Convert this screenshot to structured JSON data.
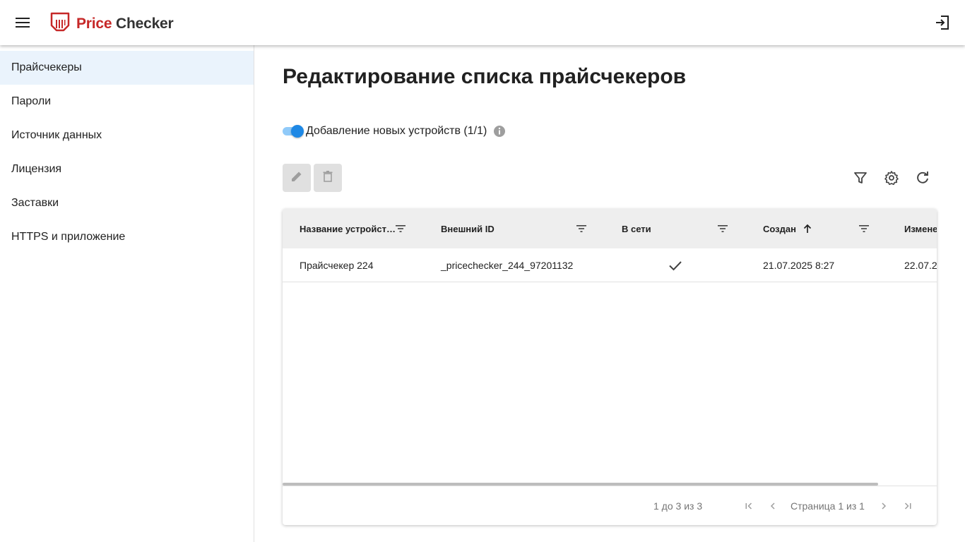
{
  "app": {
    "brand_part1": "Price",
    "brand_part2": "Checker",
    "brand_color": "#c62828",
    "icons": {
      "menu": "menu-icon",
      "logo": "barcode-tag-icon",
      "exit": "exit-icon"
    }
  },
  "sidebar": {
    "items": [
      {
        "label": "Прайсчекеры",
        "active": true
      },
      {
        "label": "Пароли"
      },
      {
        "label": "Источник данных"
      },
      {
        "label": "Лицензия"
      },
      {
        "label": "Заставки"
      },
      {
        "label": "HTTPS и приложение"
      }
    ],
    "active_bg": "#eaf3fc"
  },
  "main": {
    "title": "Редактирование списка прайсчекеров",
    "toggle": {
      "label": "Добавление новых устройств (1/1)",
      "checked": true,
      "color": "#1e88e5"
    },
    "toolbar": {
      "left": [
        {
          "icon": "edit-icon",
          "disabled": true
        },
        {
          "icon": "delete-icon",
          "disabled": true
        }
      ],
      "right": [
        {
          "icon": "filter-icon"
        },
        {
          "icon": "settings-icon"
        },
        {
          "icon": "refresh-icon"
        }
      ]
    },
    "grid": {
      "columns": [
        {
          "label": "Название устройст…",
          "filter": true
        },
        {
          "label": "Внешний ID",
          "filter": true
        },
        {
          "label": "В сети",
          "filter": true
        },
        {
          "label": "Создан",
          "sort": "asc",
          "filter": true
        },
        {
          "label": "Измене"
        }
      ],
      "rows": [
        {
          "name": "Прайсчекер 224",
          "external_id": "_pricechecker_244_97201132",
          "online": true,
          "created": "21.07.2025 8:27",
          "modified": "22.07.2"
        }
      ],
      "footer": {
        "range": "1 до 3 из 3",
        "page": "Страница 1 из 1"
      }
    }
  }
}
